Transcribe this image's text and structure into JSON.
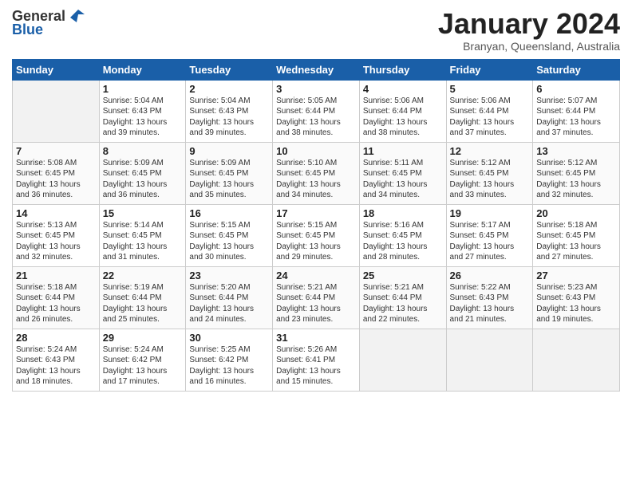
{
  "header": {
    "logo_general": "General",
    "logo_blue": "Blue",
    "month_title": "January 2024",
    "subtitle": "Branyan, Queensland, Australia"
  },
  "weekdays": [
    "Sunday",
    "Monday",
    "Tuesday",
    "Wednesday",
    "Thursday",
    "Friday",
    "Saturday"
  ],
  "weeks": [
    [
      {
        "day": "",
        "info": ""
      },
      {
        "day": "1",
        "info": "Sunrise: 5:04 AM\nSunset: 6:43 PM\nDaylight: 13 hours\nand 39 minutes."
      },
      {
        "day": "2",
        "info": "Sunrise: 5:04 AM\nSunset: 6:43 PM\nDaylight: 13 hours\nand 39 minutes."
      },
      {
        "day": "3",
        "info": "Sunrise: 5:05 AM\nSunset: 6:44 PM\nDaylight: 13 hours\nand 38 minutes."
      },
      {
        "day": "4",
        "info": "Sunrise: 5:06 AM\nSunset: 6:44 PM\nDaylight: 13 hours\nand 38 minutes."
      },
      {
        "day": "5",
        "info": "Sunrise: 5:06 AM\nSunset: 6:44 PM\nDaylight: 13 hours\nand 37 minutes."
      },
      {
        "day": "6",
        "info": "Sunrise: 5:07 AM\nSunset: 6:44 PM\nDaylight: 13 hours\nand 37 minutes."
      }
    ],
    [
      {
        "day": "7",
        "info": "Sunrise: 5:08 AM\nSunset: 6:45 PM\nDaylight: 13 hours\nand 36 minutes."
      },
      {
        "day": "8",
        "info": "Sunrise: 5:09 AM\nSunset: 6:45 PM\nDaylight: 13 hours\nand 36 minutes."
      },
      {
        "day": "9",
        "info": "Sunrise: 5:09 AM\nSunset: 6:45 PM\nDaylight: 13 hours\nand 35 minutes."
      },
      {
        "day": "10",
        "info": "Sunrise: 5:10 AM\nSunset: 6:45 PM\nDaylight: 13 hours\nand 34 minutes."
      },
      {
        "day": "11",
        "info": "Sunrise: 5:11 AM\nSunset: 6:45 PM\nDaylight: 13 hours\nand 34 minutes."
      },
      {
        "day": "12",
        "info": "Sunrise: 5:12 AM\nSunset: 6:45 PM\nDaylight: 13 hours\nand 33 minutes."
      },
      {
        "day": "13",
        "info": "Sunrise: 5:12 AM\nSunset: 6:45 PM\nDaylight: 13 hours\nand 32 minutes."
      }
    ],
    [
      {
        "day": "14",
        "info": "Sunrise: 5:13 AM\nSunset: 6:45 PM\nDaylight: 13 hours\nand 32 minutes."
      },
      {
        "day": "15",
        "info": "Sunrise: 5:14 AM\nSunset: 6:45 PM\nDaylight: 13 hours\nand 31 minutes."
      },
      {
        "day": "16",
        "info": "Sunrise: 5:15 AM\nSunset: 6:45 PM\nDaylight: 13 hours\nand 30 minutes."
      },
      {
        "day": "17",
        "info": "Sunrise: 5:15 AM\nSunset: 6:45 PM\nDaylight: 13 hours\nand 29 minutes."
      },
      {
        "day": "18",
        "info": "Sunrise: 5:16 AM\nSunset: 6:45 PM\nDaylight: 13 hours\nand 28 minutes."
      },
      {
        "day": "19",
        "info": "Sunrise: 5:17 AM\nSunset: 6:45 PM\nDaylight: 13 hours\nand 27 minutes."
      },
      {
        "day": "20",
        "info": "Sunrise: 5:18 AM\nSunset: 6:45 PM\nDaylight: 13 hours\nand 27 minutes."
      }
    ],
    [
      {
        "day": "21",
        "info": "Sunrise: 5:18 AM\nSunset: 6:44 PM\nDaylight: 13 hours\nand 26 minutes."
      },
      {
        "day": "22",
        "info": "Sunrise: 5:19 AM\nSunset: 6:44 PM\nDaylight: 13 hours\nand 25 minutes."
      },
      {
        "day": "23",
        "info": "Sunrise: 5:20 AM\nSunset: 6:44 PM\nDaylight: 13 hours\nand 24 minutes."
      },
      {
        "day": "24",
        "info": "Sunrise: 5:21 AM\nSunset: 6:44 PM\nDaylight: 13 hours\nand 23 minutes."
      },
      {
        "day": "25",
        "info": "Sunrise: 5:21 AM\nSunset: 6:44 PM\nDaylight: 13 hours\nand 22 minutes."
      },
      {
        "day": "26",
        "info": "Sunrise: 5:22 AM\nSunset: 6:43 PM\nDaylight: 13 hours\nand 21 minutes."
      },
      {
        "day": "27",
        "info": "Sunrise: 5:23 AM\nSunset: 6:43 PM\nDaylight: 13 hours\nand 19 minutes."
      }
    ],
    [
      {
        "day": "28",
        "info": "Sunrise: 5:24 AM\nSunset: 6:43 PM\nDaylight: 13 hours\nand 18 minutes."
      },
      {
        "day": "29",
        "info": "Sunrise: 5:24 AM\nSunset: 6:42 PM\nDaylight: 13 hours\nand 17 minutes."
      },
      {
        "day": "30",
        "info": "Sunrise: 5:25 AM\nSunset: 6:42 PM\nDaylight: 13 hours\nand 16 minutes."
      },
      {
        "day": "31",
        "info": "Sunrise: 5:26 AM\nSunset: 6:41 PM\nDaylight: 13 hours\nand 15 minutes."
      },
      {
        "day": "",
        "info": ""
      },
      {
        "day": "",
        "info": ""
      },
      {
        "day": "",
        "info": ""
      }
    ]
  ]
}
